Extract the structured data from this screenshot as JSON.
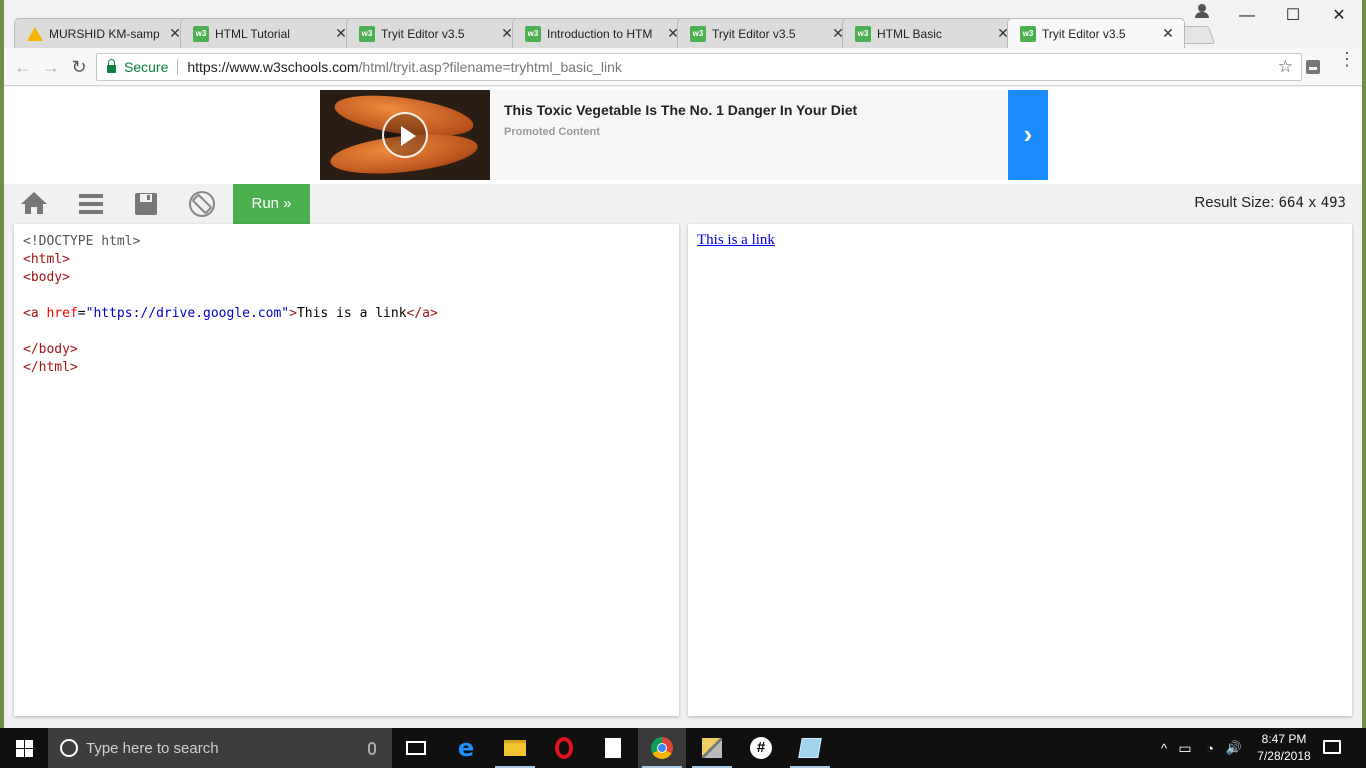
{
  "browser": {
    "tabs": [
      {
        "title": "MURSHID KM-samp",
        "favicon": "google-drive-icon",
        "active": false
      },
      {
        "title": "HTML Tutorial",
        "favicon": "w3schools-icon",
        "active": false
      },
      {
        "title": "Tryit Editor v3.5",
        "favicon": "w3schools-icon",
        "active": false
      },
      {
        "title": "Introduction to HTM",
        "favicon": "w3schools-icon",
        "active": false
      },
      {
        "title": "Tryit Editor v3.5",
        "favicon": "w3schools-icon",
        "active": false
      },
      {
        "title": "HTML Basic",
        "favicon": "w3schools-icon",
        "active": false
      },
      {
        "title": "Tryit Editor v3.5",
        "favicon": "w3schools-icon",
        "active": true
      }
    ],
    "favicon_w3_text": "w3",
    "tab_close_glyph": "✕",
    "window_controls": {
      "minimize": "—",
      "maximize": "☐",
      "close": "✕"
    },
    "nav": {
      "back": "←",
      "forward": "→",
      "reload": "↻"
    },
    "address": {
      "secure_label": "Secure",
      "url_host": "https://www.w3schools.com",
      "url_path": "/html/tryit.asp?filename=tryhtml_basic_link"
    },
    "bookmark_star": "☆",
    "menu_glyph": "⋮"
  },
  "ad": {
    "title": "This Toxic Vegetable Is The No. 1 Danger In Your Diet",
    "subtitle": "Promoted Content",
    "arrow": "›",
    "accent_color": "#1a8cff"
  },
  "tryit": {
    "run_label": "Run »",
    "result_size_label": "Result Size:",
    "result_width": "664",
    "result_times": "x",
    "result_height": "493",
    "run_color": "#4caf50"
  },
  "code": {
    "doctype": "<!DOCTYPE html>",
    "html_open": "<html>",
    "body_open": "<body>",
    "a_open_start": "<a",
    "a_attr": "href",
    "a_eq": "=",
    "a_value": "\"https://drive.google.com\"",
    "a_open_end": ">",
    "a_text": "This is a link",
    "a_close": "</a>",
    "body_close": "</body>",
    "html_close": "</html>"
  },
  "result": {
    "link_text": "This is a link",
    "link_href": "https://drive.google.com"
  },
  "taskbar": {
    "search_placeholder": "Type here to search",
    "apps": [
      "task-view-icon",
      "edge-icon",
      "file-explorer-icon",
      "opera-icon",
      "file-icon",
      "chrome-icon",
      "tools-icon",
      "slack-icon",
      "paint-icon"
    ],
    "tray": {
      "chevron": "^",
      "battery": "▭",
      "wifi": "◔",
      "volume": "🔊"
    },
    "time": "8:47 PM",
    "date": "7/28/2018"
  }
}
